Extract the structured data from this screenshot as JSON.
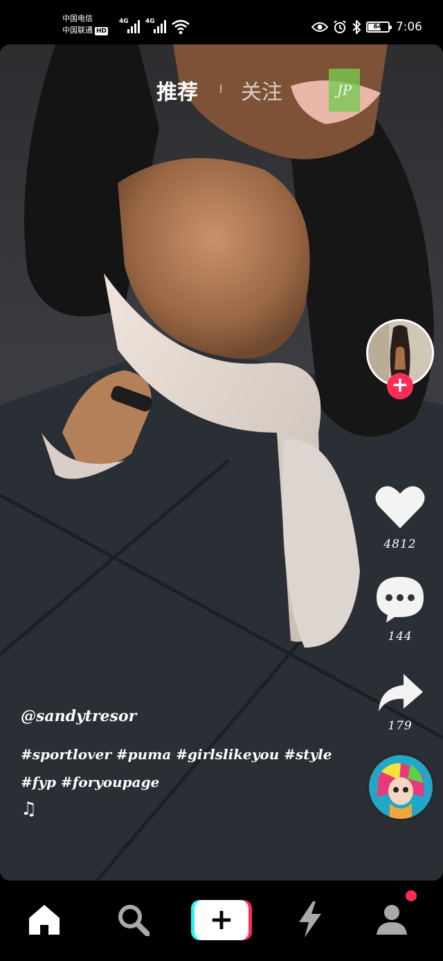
{
  "status_bar": {
    "carrier_1": "中国电信",
    "carrier_2": "中国联通",
    "hd_badge": "HD",
    "network_1": "4G",
    "network_2": "4G",
    "battery_level": "64",
    "time": "7:06",
    "icons": [
      "signal-icon",
      "wifi-icon",
      "eye-icon",
      "alarm-icon",
      "bluetooth-icon",
      "battery-icon"
    ]
  },
  "top_tabs": {
    "recommend": "推荐",
    "following": "关注",
    "badge": "JP"
  },
  "right_rail": {
    "likes": "4812",
    "comments": "144",
    "shares": "179",
    "follow_symbol": "+"
  },
  "caption": {
    "username": "@sandytresor",
    "hashtags_line1": "#sportlover #puma #girlslikeyou #style",
    "hashtags_line2": "#fyp #foryoupage",
    "music_symbol": "♫"
  },
  "bottom_nav": {
    "items": [
      "home-icon",
      "search-icon",
      "create-button",
      "flash-icon",
      "profile-icon"
    ],
    "create_symbol": "+"
  },
  "colors": {
    "accent_red": "#fe2c55",
    "accent_cyan": "#25f4ee",
    "background": "#000000"
  }
}
